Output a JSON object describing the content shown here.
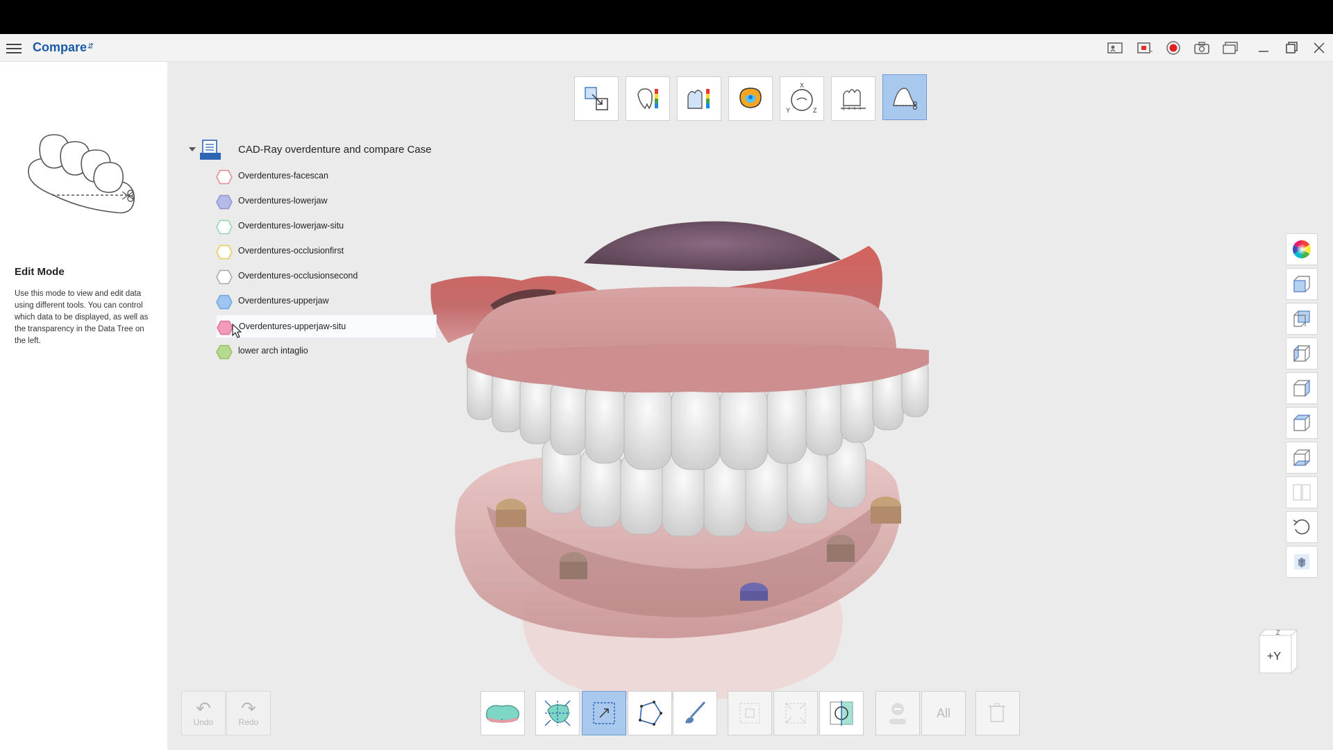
{
  "app": {
    "title": "Compare",
    "title_mark": "⇵"
  },
  "window_buttons": [
    {
      "name": "help-video-icon"
    },
    {
      "name": "screen-record-area-icon"
    },
    {
      "name": "record-icon"
    },
    {
      "name": "screenshot-icon"
    },
    {
      "name": "window-mode-icon"
    },
    {
      "name": "minimize-icon"
    },
    {
      "name": "restore-icon"
    },
    {
      "name": "close-icon"
    }
  ],
  "sidebar": {
    "heading": "Edit Mode",
    "description": "Use this mode to view and edit data using different tools. You can control which data to be displayed, as well as the transparency in the Data Tree on the left."
  },
  "top_tools": [
    {
      "name": "align-tool-icon",
      "active": false
    },
    {
      "name": "deviation-map-tool-icon",
      "active": false
    },
    {
      "name": "cross-section-color-tool-icon",
      "active": false
    },
    {
      "name": "occlusion-tool-icon",
      "active": false
    },
    {
      "name": "axis-tool-icon",
      "active": false
    },
    {
      "name": "measure-tool-icon",
      "active": false
    },
    {
      "name": "edit-trim-tool-icon",
      "active": true
    }
  ],
  "tree": {
    "case_name": "CAD-Ray overdenture and compare Case",
    "items": [
      {
        "label": "Overdentures-facescan",
        "stroke": "#e8868c",
        "fill": "none"
      },
      {
        "label": "Overdentures-lowerjaw",
        "stroke": "#8d96cf",
        "fill": "#b4bbe6"
      },
      {
        "label": "Overdentures-lowerjaw-situ",
        "stroke": "#8fd6a6",
        "fill": "none"
      },
      {
        "label": "Overdentures-occlusionfirst",
        "stroke": "#f0c850",
        "fill": "none"
      },
      {
        "label": "Overdentures-occlusionsecond",
        "stroke": "#a8a8a8",
        "fill": "none"
      },
      {
        "label": "Overdentures-upperjaw",
        "stroke": "#6da4e0",
        "fill": "#9fc6f2"
      },
      {
        "label": "Overdentures-upperjaw-situ",
        "stroke": "#e76f97",
        "fill": "#f29bbb"
      },
      {
        "label": "lower arch intaglio",
        "stroke": "#98c06a",
        "fill": "#b7d98e"
      }
    ]
  },
  "right_tools": [
    {
      "name": "color-wheel-icon"
    },
    {
      "name": "view-front-icon"
    },
    {
      "name": "view-back-icon"
    },
    {
      "name": "view-left-icon"
    },
    {
      "name": "view-right-icon"
    },
    {
      "name": "view-top-icon"
    },
    {
      "name": "view-bottom-icon"
    },
    {
      "name": "split-view-icon"
    },
    {
      "name": "reset-view-icon"
    },
    {
      "name": "solid-view-icon"
    }
  ],
  "orientation_cube": {
    "label": "+Y",
    "top_label": "Z"
  },
  "bottom_left": {
    "undo": "Undo",
    "redo": "Redo"
  },
  "bottom_tools": [
    {
      "name": "jaw-select-icon",
      "state": "normal"
    },
    {
      "name": "select-through-icon",
      "state": "normal"
    },
    {
      "name": "rectangle-select-icon",
      "state": "active"
    },
    {
      "name": "polygon-select-icon",
      "state": "normal"
    },
    {
      "name": "brush-select-icon",
      "state": "normal"
    },
    {
      "name": "invert-selection-icon",
      "state": "disabled"
    },
    {
      "name": "expand-selection-icon",
      "state": "disabled"
    },
    {
      "name": "plane-cut-icon",
      "state": "normal"
    },
    {
      "name": "deselect-off-icon",
      "state": "disabled"
    },
    {
      "name": "select-all-icon",
      "state": "disabled",
      "label": "All"
    },
    {
      "name": "delete-selection-icon",
      "state": "disabled"
    }
  ],
  "colors": {
    "accent": "#1a5aa8",
    "active_tool": "#a9c8ee",
    "viewport_bg": "#ebebeb"
  }
}
